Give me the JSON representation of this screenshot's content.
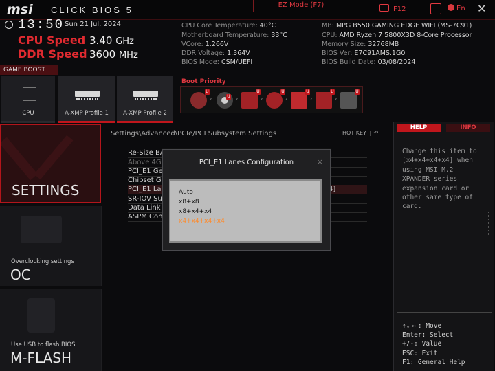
{
  "topbar": {
    "brand": "msi",
    "product": "CLICK BIOS 5",
    "ez_mode": "EZ Mode (F7)",
    "f12": "F12",
    "language": "En",
    "close": "✕"
  },
  "clock": {
    "time": "13:50",
    "date": "Sun 21 Jul, 2024"
  },
  "speeds": {
    "cpu_label": "CPU Speed",
    "cpu_value": "3.40",
    "cpu_unit": "GHz",
    "ddr_label": "DDR Speed",
    "ddr_value": "3600",
    "ddr_unit": "MHz"
  },
  "sysinfo": {
    "left": [
      {
        "label": "CPU Core Temperature: ",
        "value": "40°C"
      },
      {
        "label": "Motherboard Temperature: ",
        "value": "33°C"
      },
      {
        "label": "VCore: ",
        "value": "1.266V"
      },
      {
        "label": "DDR Voltage: ",
        "value": "1.364V"
      },
      {
        "label": "BIOS Mode: ",
        "value": "CSM/UEFI"
      }
    ],
    "right": [
      {
        "label": "MB: ",
        "value": "MPG B550 GAMING EDGE WIFI (MS-7C91)"
      },
      {
        "label": "CPU: ",
        "value": "AMD Ryzen 7 5800X3D 8-Core Processor"
      },
      {
        "label": "Memory Size: ",
        "value": "32768MB"
      },
      {
        "label": "BIOS Ver: ",
        "value": "E7C91AMS.1G0"
      },
      {
        "label": "BIOS Build Date: ",
        "value": "03/08/2024"
      }
    ]
  },
  "game_boost": {
    "label": "GAME BOOST",
    "tiles": [
      {
        "label": "CPU",
        "active": false
      },
      {
        "label": "A-XMP Profile 1",
        "active": true
      },
      {
        "label": "A-XMP Profile 2",
        "active": true
      }
    ]
  },
  "boot_priority": {
    "label": "Boot Priority",
    "devices": [
      "hdd-icon",
      "optical-disc-icon",
      "usb-drive-icon",
      "usb-optical-icon",
      "usb-key-icon",
      "usb-hdd-icon",
      "network-icon"
    ],
    "badge": "U"
  },
  "nav": {
    "settings": "SETTINGS",
    "oc_sub": "Overclocking settings",
    "oc": "OC",
    "mflash_sub": "Use USB to flash BIOS",
    "mflash": "M-FLASH"
  },
  "main": {
    "breadcrumb": "Settings\\Advanced\\PCIe/PCI Subsystem Settings",
    "hotkey": "HOT KEY",
    "rows": [
      {
        "label": "Re-Size BAR Support",
        "dim": false,
        "selected": false
      },
      {
        "label": "Above 4G memory/Crypto Currency mining",
        "dim": true,
        "selected": false
      },
      {
        "label": "PCI_E1 Gen Switch",
        "dim": false,
        "selected": false
      },
      {
        "label": "Chipset Gen Switch",
        "dim": false,
        "selected": false
      },
      {
        "label": "PCI_E1 Lanes Configuration",
        "dim": false,
        "selected": true
      },
      {
        "label": "SR-IOV Support",
        "dim": false,
        "selected": false
      },
      {
        "label": "Data Link Feature Exchange",
        "dim": false,
        "selected": false
      },
      {
        "label": "ASPM Control",
        "dim": false,
        "selected": false
      }
    ],
    "selected_value": "4]"
  },
  "modal": {
    "title": "PCI_E1 Lanes Configuration",
    "close": "×",
    "options": [
      "Auto",
      "x8+x8",
      "x8+x4+x4",
      "x4+x4+x4+x4"
    ],
    "selected_index": 3
  },
  "help": {
    "help_tab": "HELP",
    "info_tab": "INFO",
    "text": "Change this item to [x4+x4+x4+x4] when using MSI M.2 XPANDER series expansion card or other same type of card.",
    "keys": "↑↓→←: Move\nEnter: Select\n+/-: Value\nESC: Exit\nF1: General Help"
  },
  "colors": {
    "accent": "#c0161c",
    "accent_text": "#e03840",
    "selected_option": "#ff8a2a"
  }
}
